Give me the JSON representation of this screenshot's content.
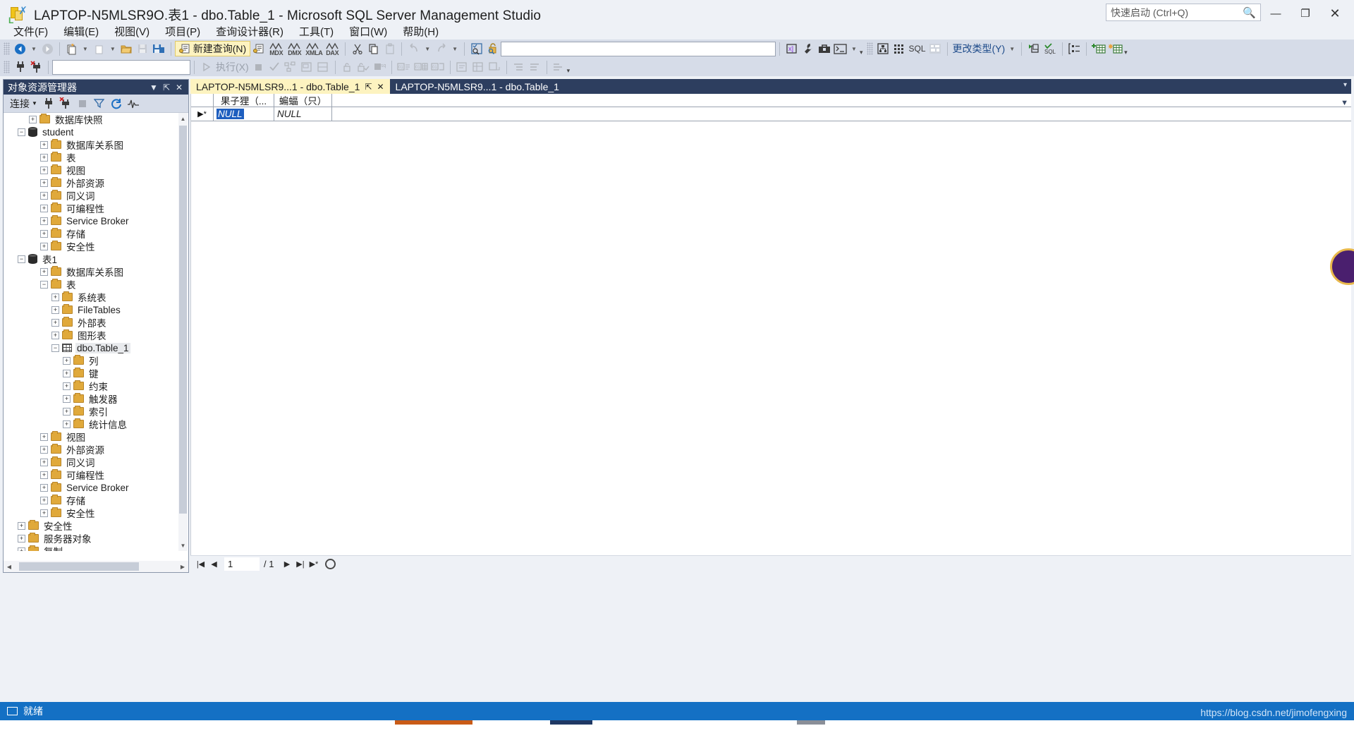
{
  "window": {
    "title": "LAPTOP-N5MLSR9O.表1 - dbo.Table_1 - Microsoft SQL Server Management Studio",
    "app_icon": "ssms-icon",
    "minimize": "—",
    "maximize": "❐",
    "close": "✕"
  },
  "quick_launch": {
    "placeholder": "快速启动 (Ctrl+Q)",
    "icon": "search-icon"
  },
  "menu": {
    "items": [
      {
        "label": "文件(F)"
      },
      {
        "label": "编辑(E)"
      },
      {
        "label": "视图(V)"
      },
      {
        "label": "项目(P)"
      },
      {
        "label": "查询设计器(R)"
      },
      {
        "label": "工具(T)"
      },
      {
        "label": "窗口(W)"
      },
      {
        "label": "帮助(H)"
      }
    ]
  },
  "toolbar1": {
    "back": "◀",
    "forward": "▶",
    "new_project": "新建项目",
    "new_item": "新建项",
    "open_file": "打开文件",
    "save": "保存",
    "save_all": "全部保存",
    "new_query_label": "新建查询(N)",
    "db_engine_query": "数据库引擎查询",
    "mdx_query": "MDX",
    "dmx_query": "DMX",
    "xmla_query": "XMLA",
    "dax_query": "DAX",
    "cut": "✂",
    "copy": "⧉",
    "paste": "📋",
    "undo": "↶",
    "redo": "↷",
    "find": "🔍",
    "unlock": "🔓",
    "combo_value": "",
    "vs_tool": "Visual Studio",
    "wrench": "🔧",
    "toolbox": "🧰",
    "console": ">_",
    "object_explorer": "对象资源管理器",
    "registered_servers": "已注册的服务器",
    "sql_label": "SQL",
    "template_explorer": "模板资源管理器",
    "change_type_label": "更改类型(Y)",
    "run_sql": "执行 SQL",
    "verify_sql": "验证 SQL",
    "properties": "属性",
    "add_table": "添加表",
    "add_new_derived_table": "添加新派生表",
    "overflow": "▾"
  },
  "toolbar2": {
    "connect_icon": "connect-icon",
    "disconnect_icon": "disconnect-icon",
    "db_combo_value": "",
    "execute_label": "执行(X)",
    "stop": "■",
    "parse": "✓",
    "display_estimated_plan": "显示估计的执行计划",
    "include_actual_plan": "包括实际的执行计划",
    "client_statistics": "包括客户端统计信息",
    "results_to_text": "以文本格式显示结果",
    "results_to_grid": "以网格显示结果",
    "results_to_file": "将结果保存到文件",
    "comment_out": "注释选中行",
    "uncomment": "取消注释选中行",
    "indent": "增加缩进",
    "outdent": "减少缩进"
  },
  "object_explorer": {
    "title": "对象资源管理器",
    "header_icons": [
      "chevron-down-icon"
    ],
    "connect_label": "连接",
    "toolbar_icons": [
      "connect-icon",
      "disconnect-icon",
      "stop-icon",
      "filter-icon",
      "refresh-icon",
      "activity-monitor-icon"
    ],
    "tree": [
      {
        "label": "数据库快照",
        "icon": "folder",
        "indent": 2,
        "state": "collapsed"
      },
      {
        "label": "student",
        "icon": "database",
        "indent": 1,
        "state": "expanded"
      },
      {
        "label": "数据库关系图",
        "icon": "folder",
        "indent": 3,
        "state": "collapsed"
      },
      {
        "label": "表",
        "icon": "folder",
        "indent": 3,
        "state": "collapsed"
      },
      {
        "label": "视图",
        "icon": "folder",
        "indent": 3,
        "state": "collapsed"
      },
      {
        "label": "外部资源",
        "icon": "folder",
        "indent": 3,
        "state": "collapsed"
      },
      {
        "label": "同义词",
        "icon": "folder",
        "indent": 3,
        "state": "collapsed"
      },
      {
        "label": "可编程性",
        "icon": "folder",
        "indent": 3,
        "state": "collapsed"
      },
      {
        "label": "Service Broker",
        "icon": "folder",
        "indent": 3,
        "state": "collapsed"
      },
      {
        "label": "存储",
        "icon": "folder",
        "indent": 3,
        "state": "collapsed"
      },
      {
        "label": "安全性",
        "icon": "folder",
        "indent": 3,
        "state": "collapsed"
      },
      {
        "label": "表1",
        "icon": "database",
        "indent": 1,
        "state": "expanded"
      },
      {
        "label": "数据库关系图",
        "icon": "folder",
        "indent": 3,
        "state": "collapsed"
      },
      {
        "label": "表",
        "icon": "folder",
        "indent": 3,
        "state": "expanded"
      },
      {
        "label": "系统表",
        "icon": "folder",
        "indent": 4,
        "state": "collapsed"
      },
      {
        "label": "FileTables",
        "icon": "folder",
        "indent": 4,
        "state": "collapsed"
      },
      {
        "label": "外部表",
        "icon": "folder",
        "indent": 4,
        "state": "collapsed"
      },
      {
        "label": "图形表",
        "icon": "folder",
        "indent": 4,
        "state": "collapsed"
      },
      {
        "label": "dbo.Table_1",
        "icon": "table",
        "indent": 4,
        "state": "expanded",
        "selected": true
      },
      {
        "label": "列",
        "icon": "folder",
        "indent": 5,
        "state": "collapsed"
      },
      {
        "label": "键",
        "icon": "folder",
        "indent": 5,
        "state": "collapsed"
      },
      {
        "label": "约束",
        "icon": "folder",
        "indent": 5,
        "state": "collapsed"
      },
      {
        "label": "触发器",
        "icon": "folder",
        "indent": 5,
        "state": "collapsed"
      },
      {
        "label": "索引",
        "icon": "folder",
        "indent": 5,
        "state": "collapsed"
      },
      {
        "label": "统计信息",
        "icon": "folder",
        "indent": 5,
        "state": "collapsed"
      },
      {
        "label": "视图",
        "icon": "folder",
        "indent": 3,
        "state": "collapsed"
      },
      {
        "label": "外部资源",
        "icon": "folder",
        "indent": 3,
        "state": "collapsed"
      },
      {
        "label": "同义词",
        "icon": "folder",
        "indent": 3,
        "state": "collapsed"
      },
      {
        "label": "可编程性",
        "icon": "folder",
        "indent": 3,
        "state": "collapsed"
      },
      {
        "label": "Service Broker",
        "icon": "folder",
        "indent": 3,
        "state": "collapsed"
      },
      {
        "label": "存储",
        "icon": "folder",
        "indent": 3,
        "state": "collapsed"
      },
      {
        "label": "安全性",
        "icon": "folder",
        "indent": 3,
        "state": "collapsed"
      },
      {
        "label": "安全性",
        "icon": "folder",
        "indent": 1,
        "state": "collapsed"
      },
      {
        "label": "服务器对象",
        "icon": "folder",
        "indent": 1,
        "state": "collapsed"
      },
      {
        "label": "复制",
        "icon": "folder",
        "indent": 1,
        "state": "collapsed"
      }
    ]
  },
  "tabs": {
    "items": [
      {
        "label": "LAPTOP-N5MLSR9...1 - dbo.Table_1",
        "active": true,
        "pin": "⇱",
        "close": "✕"
      },
      {
        "label": "LAPTOP-N5MLSR9...1 - dbo.Table_1",
        "active": false
      }
    ],
    "overflow": "▾"
  },
  "grid": {
    "columns": [
      "",
      "果子狸（...",
      "蝙蝠（只）"
    ],
    "rows": [
      {
        "marker": "▶*",
        "cells": [
          "NULL",
          "NULL"
        ],
        "selected_cell": 0
      }
    ]
  },
  "grid_nav": {
    "first": "|◀",
    "prev": "◀",
    "current_page": "1",
    "total": "/ 1",
    "next": "▶",
    "last": "▶|",
    "new_row": "▶*",
    "stop": "◉"
  },
  "status": {
    "text": "就绪",
    "icon": "ready-icon"
  },
  "watermark": "https://blog.csdn.net/jimofengxing",
  "colors": {
    "title_bar": "#eef1f6",
    "toolbar": "#d6dce8",
    "panel_header": "#2d3e5f",
    "active_tab": "#fdf3c0",
    "status_bar": "#1470c4",
    "selection": "#1f5fbf",
    "folder": "#e0a93b"
  }
}
